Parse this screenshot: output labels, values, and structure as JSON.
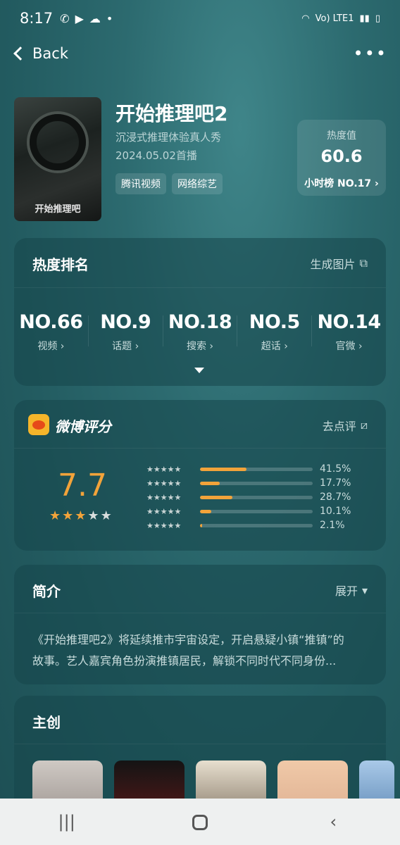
{
  "status_bar": {
    "time": "8:17",
    "network": "Vo) LTE1"
  },
  "nav": {
    "back_label": "Back",
    "more_label": "•••"
  },
  "show": {
    "title": "开始推理吧2",
    "subtitle": "沉浸式推理体验真人秀",
    "date": "2024.05.02首播",
    "tags": [
      "腾讯视频",
      "网络综艺"
    ],
    "poster_text": "开始推理吧"
  },
  "heat": {
    "label": "热度值",
    "value": "60.6",
    "rank": "小时榜 NO.17 ›"
  },
  "ranking": {
    "title": "热度排名",
    "action": "生成图片",
    "items": [
      {
        "value": "NO.66",
        "label": "视频 ›"
      },
      {
        "value": "NO.9",
        "label": "话题 ›"
      },
      {
        "value": "NO.18",
        "label": "搜索 ›"
      },
      {
        "value": "NO.5",
        "label": "超话 ›"
      },
      {
        "value": "NO.14",
        "label": "官微 ›"
      }
    ]
  },
  "score": {
    "title": "微博评分",
    "action": "去点评",
    "value": "7.7",
    "stars_filled": 3,
    "stars_total": 5,
    "distribution": [
      {
        "stars": 5,
        "pct_label": "41.5%",
        "pct": 41.5
      },
      {
        "stars": 4,
        "pct_label": "17.7%",
        "pct": 17.7
      },
      {
        "stars": 3,
        "pct_label": "28.7%",
        "pct": 28.7
      },
      {
        "stars": 2,
        "pct_label": "10.1%",
        "pct": 10.1
      },
      {
        "stars": 1,
        "pct_label": "2.1%",
        "pct": 2.1
      }
    ],
    "accent_color": "#f2a33a"
  },
  "intro": {
    "title": "简介",
    "action": "展开",
    "line1": "《开始推理吧2》将延续推市宇宙设定，开启悬疑小镇“推镇”的",
    "line2": "故事。艺人嘉宾角色扮演推镇居民，解锁不同时代不同身份..."
  },
  "cast": {
    "title": "主创"
  },
  "system_nav": {
    "recents": "|||",
    "back": "‹"
  }
}
